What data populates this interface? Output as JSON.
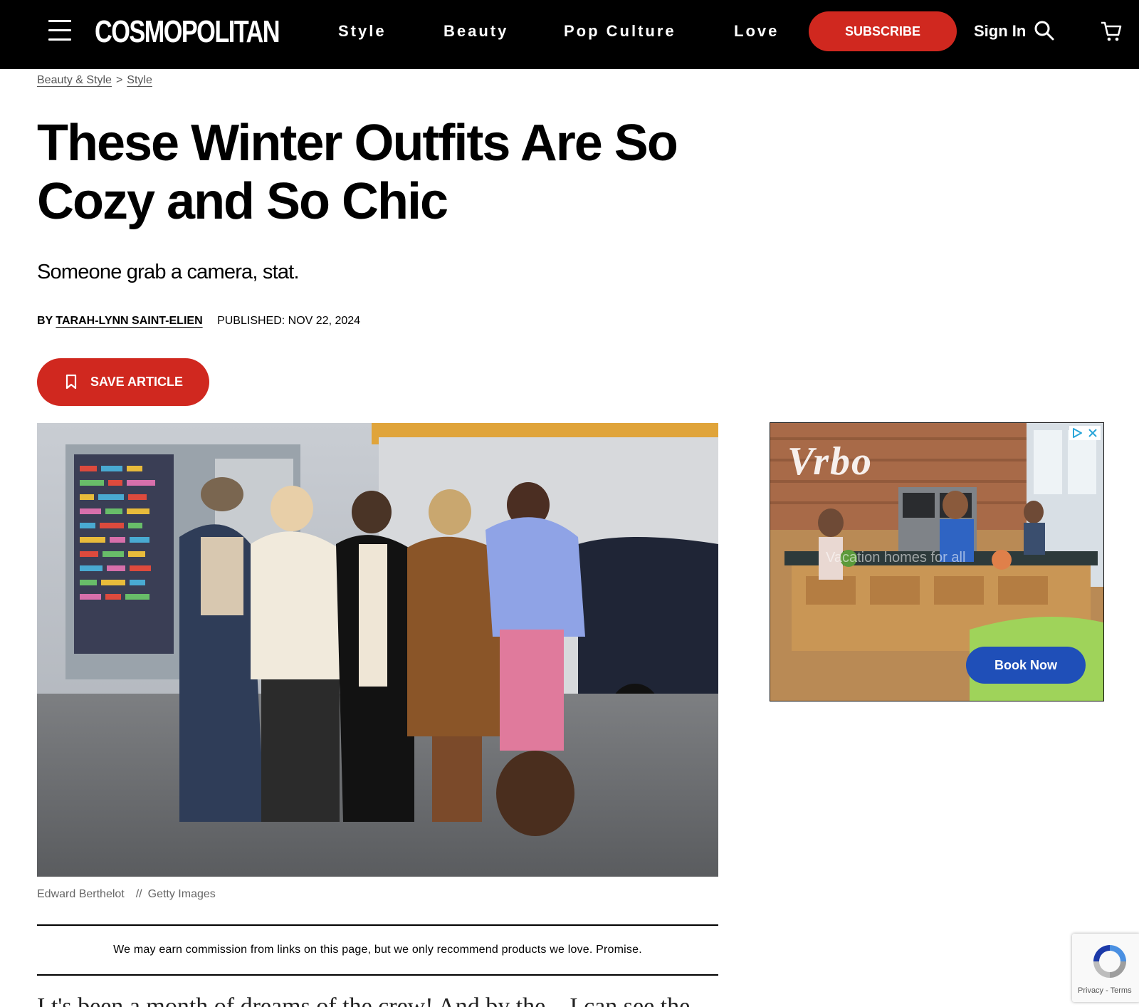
{
  "header": {
    "logo": "COSMOPOLITAN",
    "nav": [
      "Style",
      "Beauty",
      "Pop Culture",
      "Love"
    ],
    "subscribe_label": "SUBSCRIBE",
    "signin_label": "Sign In"
  },
  "breadcrumb": {
    "items": [
      "Beauty & Style",
      "Style"
    ],
    "separator": ">"
  },
  "article": {
    "title": "These Winter Outfits Are So Cozy and So Chic",
    "dek": "Someone grab a camera, stat.",
    "by_prefix": "BY",
    "author": "TARAH-LYNN SAINT-ELIEN",
    "published": "PUBLISHED: NOV 22, 2024",
    "save_label": "SAVE ARTICLE",
    "photo_credit": "Edward Berthelot",
    "photo_separator": "//",
    "photo_source": "Getty Images",
    "disclaimer": "We may earn commission from links on this page, but we only recommend products we love. Promise.",
    "body_start": "I t's been a month of dreams of the crew! And by the... I can see the"
  },
  "ad": {
    "brand": "Vrbo",
    "headline": "Vacation homes for all",
    "cta": "Book Now"
  },
  "recaptcha": {
    "links": "Privacy - Terms"
  },
  "colors": {
    "brand_red": "#d0281f",
    "header_bg": "#000000",
    "ad_cta": "#1f4fb8"
  },
  "icons": [
    "menu-icon",
    "search-icon",
    "cart-icon",
    "bookmark-icon",
    "ad-choices-icon",
    "close-icon",
    "recaptcha-icon"
  ]
}
